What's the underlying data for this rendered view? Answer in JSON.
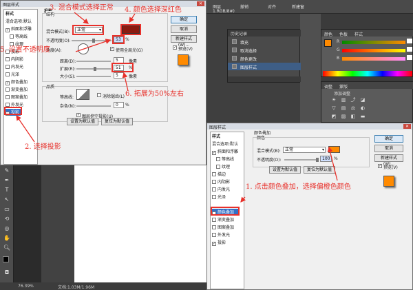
{
  "photoshop": {
    "window_tabs": {
      "tab1": "图层",
      "tab2": "1.RGB/8#)",
      "tab3": "新建窗"
    },
    "right_top": {
      "undo": "撤销",
      "freq": "对齐",
      "right": "右"
    },
    "history_panel": {
      "title": "历史记录",
      "rows": [
        "填充",
        "取消选择",
        "颜色更改",
        "图层样式"
      ]
    },
    "color_panel": {
      "tabs": [
        "颜色",
        "色板",
        "样式"
      ],
      "channels": [
        "R",
        "G",
        "B"
      ]
    },
    "adjust_panel": {
      "tabs": [
        "调整",
        "蒙版"
      ],
      "title": "添加调整"
    },
    "status": {
      "zoom": "76.39%",
      "doc": "文档:1.03M/1.96M"
    }
  },
  "dialog1": {
    "title": "图层样式",
    "styles_header": "样式",
    "styles": [
      {
        "label": "混合选项:默认",
        "checked": false,
        "selected": false
      },
      {
        "label": "斜面和浮雕",
        "checked": true,
        "selected": false
      },
      {
        "label": "等高线",
        "checked": false,
        "selected": false
      },
      {
        "label": "纹理",
        "checked": false,
        "selected": false
      },
      {
        "label": "投影",
        "checked": false,
        "selected": false
      },
      {
        "label": "内阴影",
        "checked": false,
        "selected": false
      },
      {
        "label": "内发光",
        "checked": false,
        "selected": false
      },
      {
        "label": "光泽",
        "checked": false,
        "selected": false
      },
      {
        "label": "颜色叠加",
        "checked": true,
        "selected": false
      },
      {
        "label": "渐变叠加",
        "checked": false,
        "selected": false
      },
      {
        "label": "图案叠加",
        "checked": false,
        "selected": false
      },
      {
        "label": "外发光",
        "checked": false,
        "selected": false
      },
      {
        "label": "投影",
        "checked": true,
        "selected": true
      }
    ],
    "section_title": "投影",
    "structure_title": "结构",
    "blend_mode_label": "混合模式(B):",
    "blend_mode_value": "正常",
    "shadow_color": "#8b1a10",
    "opacity_label": "不透明度(O):",
    "opacity_value": "53",
    "angle_label": "角度(A):",
    "global_light_label": "使用全局光(G)",
    "distance_label": "距离(D):",
    "distance_value": "5",
    "spread_label": "扩展(R):",
    "spread_value": "51",
    "size_label": "大小(S):",
    "size_value": "5",
    "unit_px": "像素",
    "unit_pct": "%",
    "quality_title": "品质",
    "contour_label": "等高线:",
    "antialias_label": "消除锯齿(L)",
    "noise_label": "杂色(N):",
    "noise_value": "0",
    "knockout_label": "图层挖空投影(U)",
    "btn_default": "设置为默认值",
    "btn_reset": "复位为默认值",
    "ok": "确定",
    "cancel": "取消",
    "new_style": "新建样式(W)...",
    "preview_label": "预览(V)"
  },
  "dialog2": {
    "title": "图层样式",
    "styles_header": "样式",
    "styles": [
      {
        "label": "混合选项:默认",
        "checked": false,
        "selected": false
      },
      {
        "label": "斜面和浮雕",
        "checked": true,
        "selected": false
      },
      {
        "label": "等高线",
        "checked": false,
        "selected": false
      },
      {
        "label": "纹理",
        "checked": false,
        "selected": false
      },
      {
        "label": "描边",
        "checked": false,
        "selected": false
      },
      {
        "label": "内阴影",
        "checked": false,
        "selected": false
      },
      {
        "label": "内发光",
        "checked": false,
        "selected": false
      },
      {
        "label": "光泽",
        "checked": false,
        "selected": false
      },
      {
        "label": "颜色叠加",
        "checked": true,
        "selected": true
      },
      {
        "label": "渐变叠加",
        "checked": false,
        "selected": false
      },
      {
        "label": "图案叠加",
        "checked": false,
        "selected": false
      },
      {
        "label": "外发光",
        "checked": false,
        "selected": false
      },
      {
        "label": "投影",
        "checked": true,
        "selected": false
      }
    ],
    "section_title": "颜色叠加",
    "sub_title": "颜色",
    "blend_mode_label": "混合模式(B):",
    "blend_mode_value": "正常",
    "overlay_color": "#ff8a00",
    "opacity_label": "不透明度(O):",
    "opacity_value": "100",
    "unit_pct": "%",
    "btn_default": "设置为默认值",
    "btn_reset": "复位为默认值",
    "ok": "确定",
    "cancel": "取消",
    "new_style": "新建样式(W)...",
    "preview_label": "预览(V)"
  },
  "annotations": {
    "a1": "1. 点击颜色叠加，选择偏橙色颜色",
    "a2": "2. 选择投影",
    "a3": "3. 混合模式选择正常",
    "a4": "4. 颜色选择深红色",
    "a5": "5. 设置不透明度",
    "a6": "6. 拓展为50%左右"
  },
  "colors": {
    "annotation": "#e8302a",
    "orange": "#ff8a00",
    "dark_red": "#8b1a10",
    "selection": "#3370c6"
  }
}
